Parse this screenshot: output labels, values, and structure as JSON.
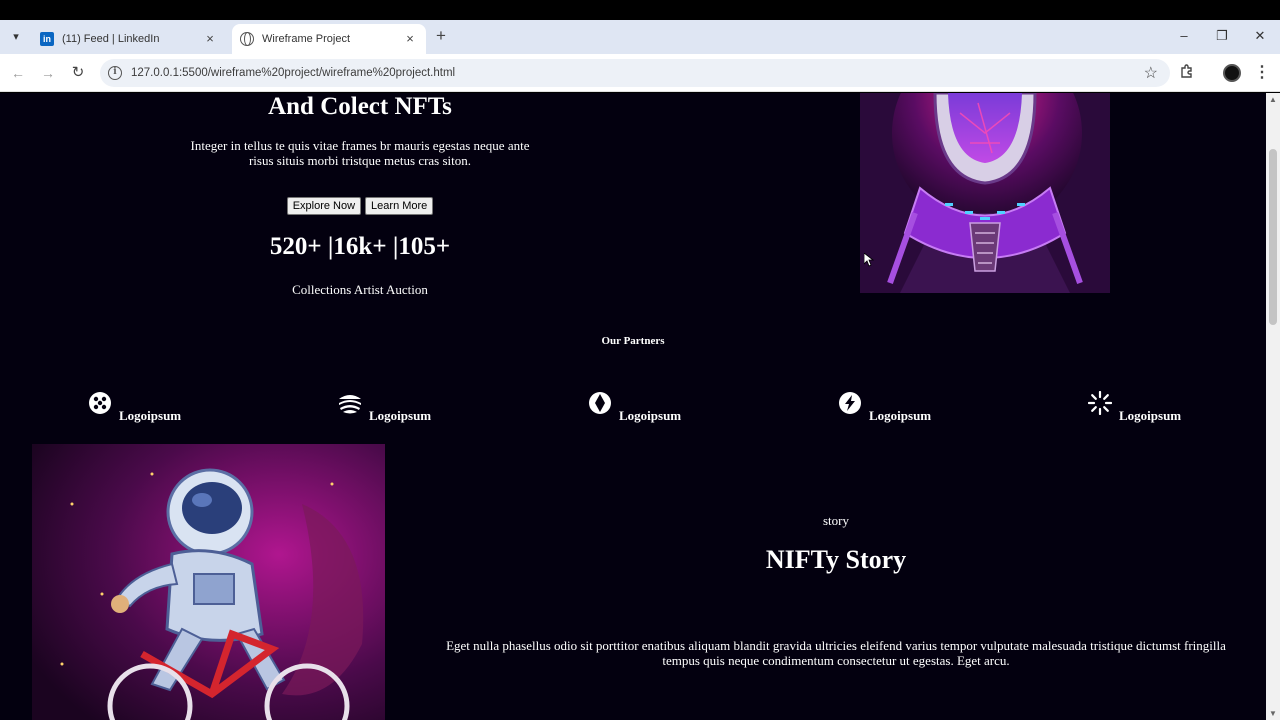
{
  "browser": {
    "tabs": [
      {
        "title": "(11) Feed | LinkedIn",
        "favicon": "linkedin-icon",
        "active": false
      },
      {
        "title": "Wireframe Project",
        "favicon": "globe-icon",
        "active": true
      }
    ],
    "url": "127.0.0.1:5500/wireframe%20project/wireframe%20project.html",
    "linkedin_favicon_text": "in"
  },
  "hero": {
    "title": "And Colect NFTs",
    "description": "Integer in tellus te quis vitae frames br mauris egestas neque ante risus situis morbi tristque metus cras siton.",
    "primary_button": "Explore Now",
    "secondary_button": "Learn More",
    "stats": "520+ |16k+ |105+",
    "stats_labels": "Collections Artist Auction"
  },
  "partners": {
    "title": "Our Partners",
    "items": [
      {
        "name": "Logoipsum",
        "icon": "dice-icon"
      },
      {
        "name": "Logoipsum",
        "icon": "waves-icon"
      },
      {
        "name": "Logoipsum",
        "icon": "diamond-icon"
      },
      {
        "name": "Logoipsum",
        "icon": "bolt-icon"
      },
      {
        "name": "Logoipsum",
        "icon": "sunburst-icon"
      }
    ]
  },
  "story": {
    "kicker": "story",
    "title": "NIFTy Story",
    "text": "Eget nulla phasellus odio sit porttitor enatibus aliquam blandit gravida ultricies eleifend varius tempor vulputate malesuada tristique dictumst fringilla tempus quis neque condimentum consectetur ut egestas. Eget arcu."
  },
  "colors": {
    "page_background": "#03000f",
    "text": "#ffffff",
    "art_magenta": "#b0168f",
    "art_purple": "#5a1a8a"
  }
}
